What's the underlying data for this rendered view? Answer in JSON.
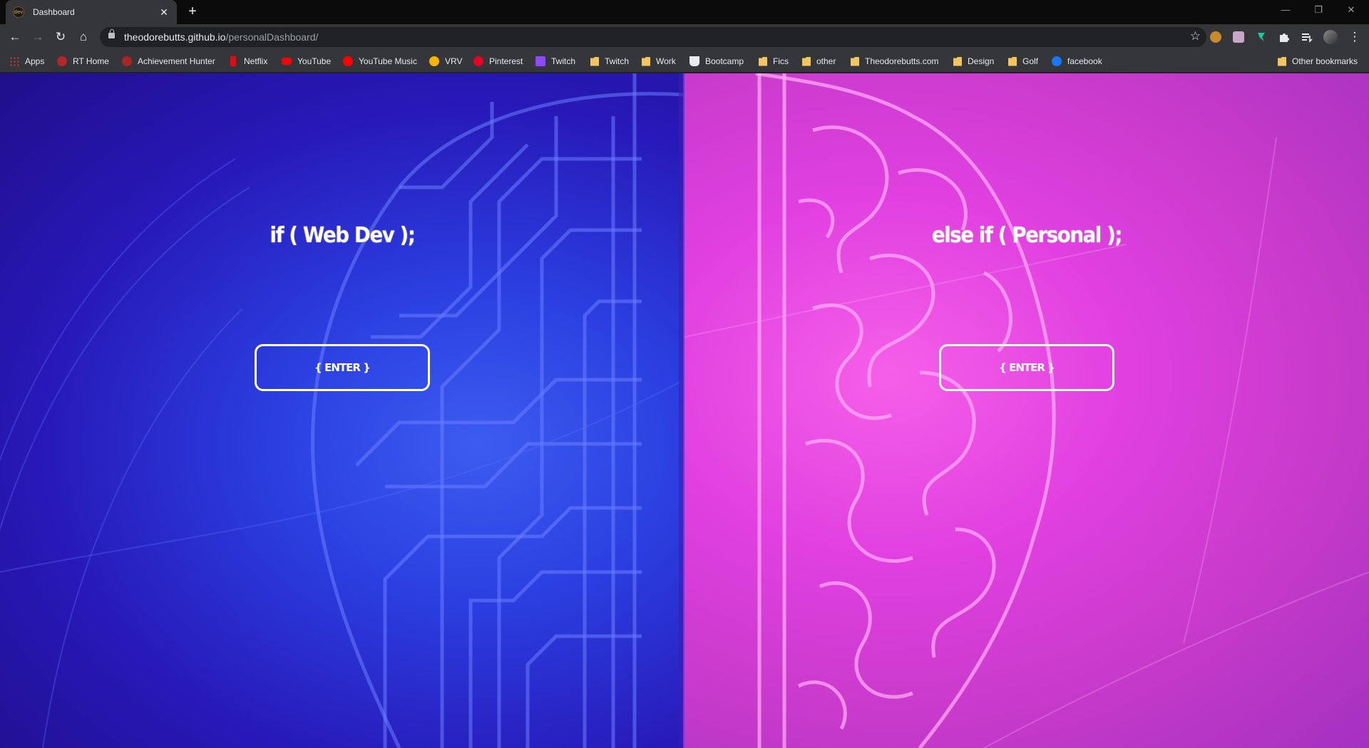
{
  "browser": {
    "tab": {
      "title": "Dashboard",
      "favicon_text": "dev",
      "close_label": "✕"
    },
    "new_tab_label": "+",
    "window_controls": {
      "minimize": "—",
      "restore": "❐",
      "close": "✕"
    },
    "address": {
      "host": "theodorebutts.github.io",
      "path": "/personalDashboard/"
    },
    "nav": {
      "back": "←",
      "forward": "→",
      "reload": "↻",
      "home": "⌂",
      "star": "☆"
    },
    "extensions": [
      "extension-icon-1",
      "extension-icon-2",
      "extension-icon-3",
      "puzzle-icon",
      "media-control-icon",
      "profile-avatar",
      "menu-icon"
    ],
    "menu_label": "⋮",
    "bookmarks": [
      {
        "label": "Apps",
        "icon": "apps-grid-icon"
      },
      {
        "label": "RT Home",
        "icon": "rooster-teeth-icon"
      },
      {
        "label": "Achievement Hunter",
        "icon": "achievement-hunter-icon"
      },
      {
        "label": "Netflix",
        "icon": "netflix-icon"
      },
      {
        "label": "YouTube",
        "icon": "youtube-icon"
      },
      {
        "label": "YouTube Music",
        "icon": "youtube-music-icon"
      },
      {
        "label": "VRV",
        "icon": "vrv-icon"
      },
      {
        "label": "Pinterest",
        "icon": "pinterest-icon"
      },
      {
        "label": "Twitch",
        "icon": "twitch-icon"
      },
      {
        "label": "Twitch",
        "icon": "folder-icon"
      },
      {
        "label": "Work",
        "icon": "folder-icon"
      },
      {
        "label": "Bootcamp",
        "icon": "bootcamp-icon"
      },
      {
        "label": "Fics",
        "icon": "folder-icon"
      },
      {
        "label": "other",
        "icon": "folder-icon"
      },
      {
        "label": "Theodorebutts.com",
        "icon": "folder-icon"
      },
      {
        "label": "Design",
        "icon": "folder-icon"
      },
      {
        "label": "Golf",
        "icon": "folder-icon"
      },
      {
        "label": "facebook",
        "icon": "facebook-icon"
      }
    ],
    "other_bookmarks": {
      "label": "Other bookmarks",
      "icon": "folder-icon"
    }
  },
  "page": {
    "left": {
      "heading": "if ( Web Dev );",
      "button": "{ ENTER }",
      "color": "#2b3fe0"
    },
    "right": {
      "heading": "else if ( Personal );",
      "button": "{ ENTER }",
      "color": "#e040e0"
    }
  }
}
